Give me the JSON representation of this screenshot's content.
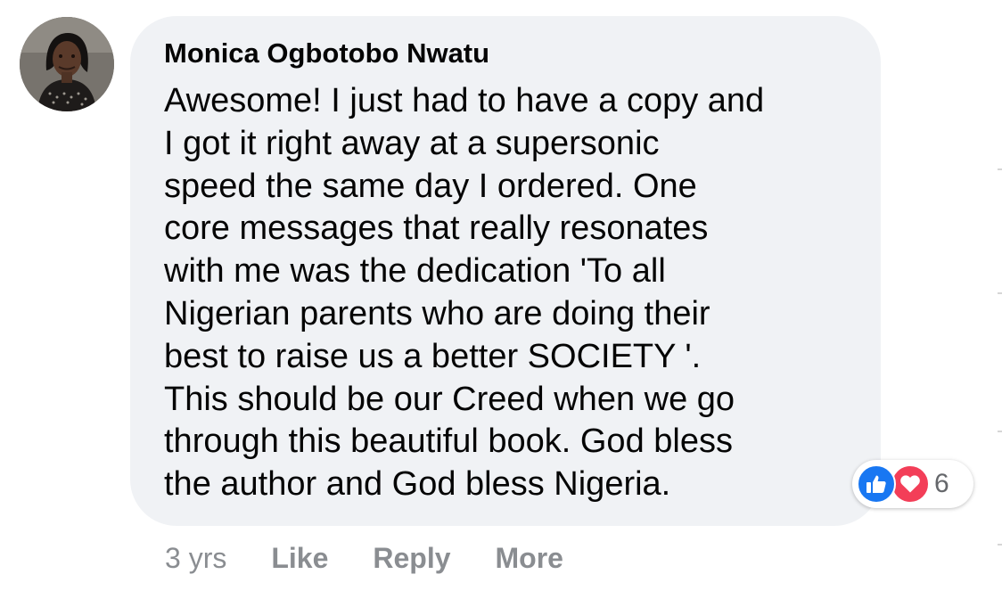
{
  "comment": {
    "author": "Monica Ogbotobo Nwatu",
    "text": "Awesome! I just had to have a copy and\nI got it right away at a supersonic\nspeed the same day I ordered. One\ncore messages that really resonates\nwith me was the dedication 'To all\nNigerian parents who are doing their\nbest to raise us a better SOCIETY '.\nThis should be our Creed when we go\nthrough this beautiful book. God bless\nthe author and God bless Nigeria.",
    "bubble_color": "#f0f2f5"
  },
  "reactions": {
    "types": [
      "like-icon",
      "love-icon"
    ],
    "count": "6",
    "like_color": "#1877f2",
    "love_color": "#f33e58"
  },
  "actions": {
    "timestamp": "3 yrs",
    "like_label": "Like",
    "reply_label": "Reply",
    "more_label": "More"
  }
}
